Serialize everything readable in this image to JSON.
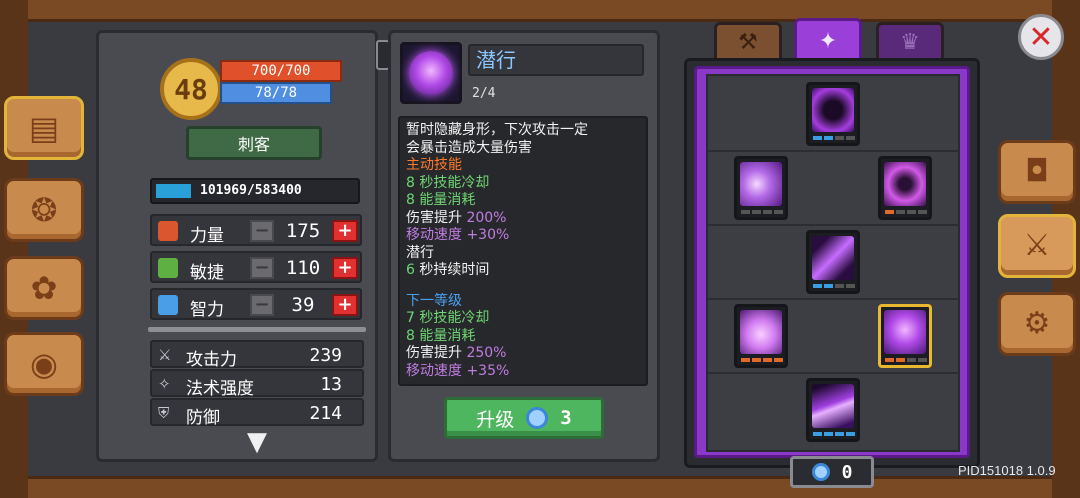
{
  "character": {
    "level": "48",
    "hp": "700/700",
    "mp": "78/78",
    "class_name": "刺客",
    "xp_text": "101969/583400",
    "xp_fraction": 0.175
  },
  "attributes": [
    {
      "label": "力量",
      "value": "175",
      "icon_color": "#d9562f",
      "icon": "fist-icon"
    },
    {
      "label": "敏捷",
      "value": "110",
      "icon_color": "#5fb042",
      "icon": "feather-icon"
    },
    {
      "label": "智力",
      "value": "39",
      "icon_color": "#4a9ee8",
      "icon": "book-icon"
    }
  ],
  "stats": [
    {
      "label": "攻击力",
      "value": "239",
      "icon": "sword-icon"
    },
    {
      "label": "法术强度",
      "value": "13",
      "icon": "wand-icon"
    },
    {
      "label": "防御",
      "value": "214",
      "icon": "shield-icon"
    }
  ],
  "skill": {
    "name": "潜行",
    "level": "2/4",
    "description": [
      {
        "text": "暂时隐藏身形，下次攻击一定",
        "color": "white"
      },
      {
        "text": "会暴击造成大量伤害",
        "color": "white"
      },
      {
        "text": "主动技能",
        "color": "orange"
      },
      {
        "text": "8 秒技能冷却",
        "color": "green"
      },
      {
        "text": "8 能量消耗",
        "color": "green"
      },
      {
        "text": "伤害提升 200%",
        "color": "white",
        "accent": "200%"
      },
      {
        "text": "移动速度 +30%",
        "color": "purple"
      },
      {
        "text": "潜行",
        "color": "white"
      },
      {
        "text": "6 秒持续时间",
        "color": "white",
        "accent": "6"
      },
      {
        "text": "",
        "color": "gap"
      },
      {
        "text": "下一等级",
        "color": "blue"
      },
      {
        "text": "7 秒技能冷却",
        "color": "green"
      },
      {
        "text": "8 能量消耗",
        "color": "green"
      },
      {
        "text": "伤害提升 250%",
        "color": "white",
        "accent": "250%"
      },
      {
        "text": "移动速度 +35%",
        "color": "purple"
      }
    ],
    "upgrade_label": "升级",
    "upgrade_cost": "3"
  },
  "skill_points": "0",
  "build_id": "PID151018 1.0.9",
  "colors": {
    "accent_purple": "#8a38c8",
    "upgrade_green": "#4fb660",
    "hp_red": "#e0502a",
    "mp_blue": "#4f8ee0"
  }
}
